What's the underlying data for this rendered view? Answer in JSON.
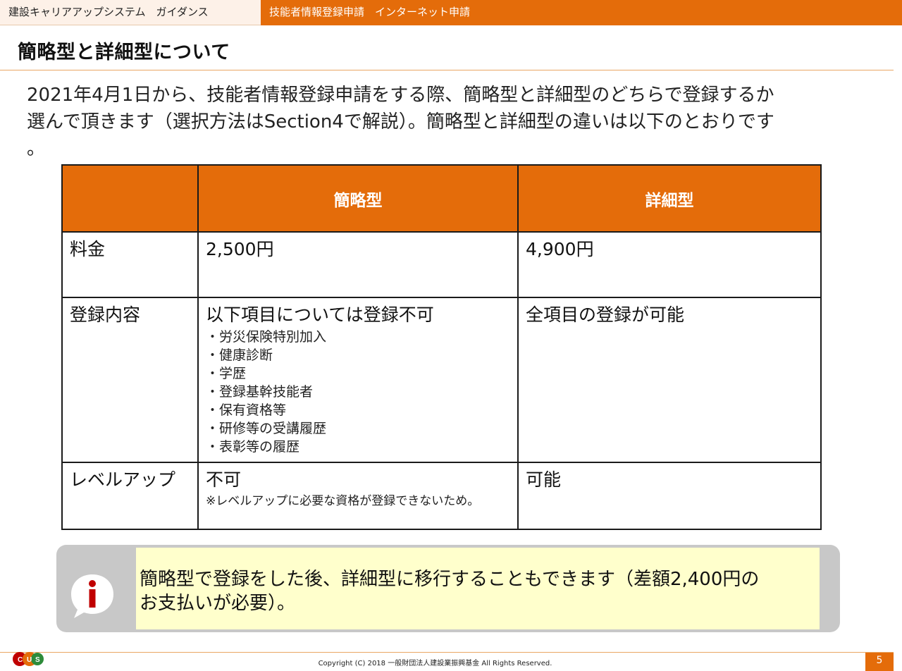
{
  "header": {
    "left_title": "建設キャリアアップシステム　ガイダンス",
    "right_title": "技能者情報登録申請　インターネット申請"
  },
  "page": {
    "title": "簡略型と詳細型について",
    "intro_lines": [
      "2021年4月1日から、技能者情報登録申請をする際、簡略型と詳細型のどちらで登録するか",
      "選んで頂きます（選択方法はSection4で解説）。簡略型と詳細型の違いは以下のとおりです",
      "。"
    ]
  },
  "table": {
    "headers": [
      "",
      "簡略型",
      "詳細型"
    ],
    "rows": {
      "fee": {
        "label": "料金",
        "simple": "2,500円",
        "detailed": "4,900円"
      },
      "content": {
        "label": "登録内容",
        "simple": "以下項目については登録不可",
        "simple_items": [
          "・労災保険特別加入",
          "・健康診断",
          "・学歴",
          "・登録基幹技能者",
          "・保有資格等",
          "・研修等の受講履歴",
          "・表彰等の履歴"
        ],
        "detailed": "全項目の登録が可能"
      },
      "levelup": {
        "label": "レベルアップ",
        "simple": "不可",
        "simple_note": "※レベルアップに必要な資格が登録できないため。",
        "detailed": "可能"
      }
    }
  },
  "info": {
    "icon": "info-i-icon",
    "line1": "簡略型で登録をした後、詳細型に移行することもできます（差額2,400円の",
    "line2": "お支払いが必要）。"
  },
  "footer": {
    "copyright": "Copyright (C) 2018 一般財団法人建設業振興基金 All Rights Reserved.",
    "page_number": "5",
    "logo_icon": "ccus-logo-icon"
  },
  "colors": {
    "accent": "#e46c0a",
    "header_left_bg": "#fdf1e8",
    "info_bg": "#ffffcc",
    "info_frame": "#c8c8c8",
    "icon_red": "#c00000"
  }
}
